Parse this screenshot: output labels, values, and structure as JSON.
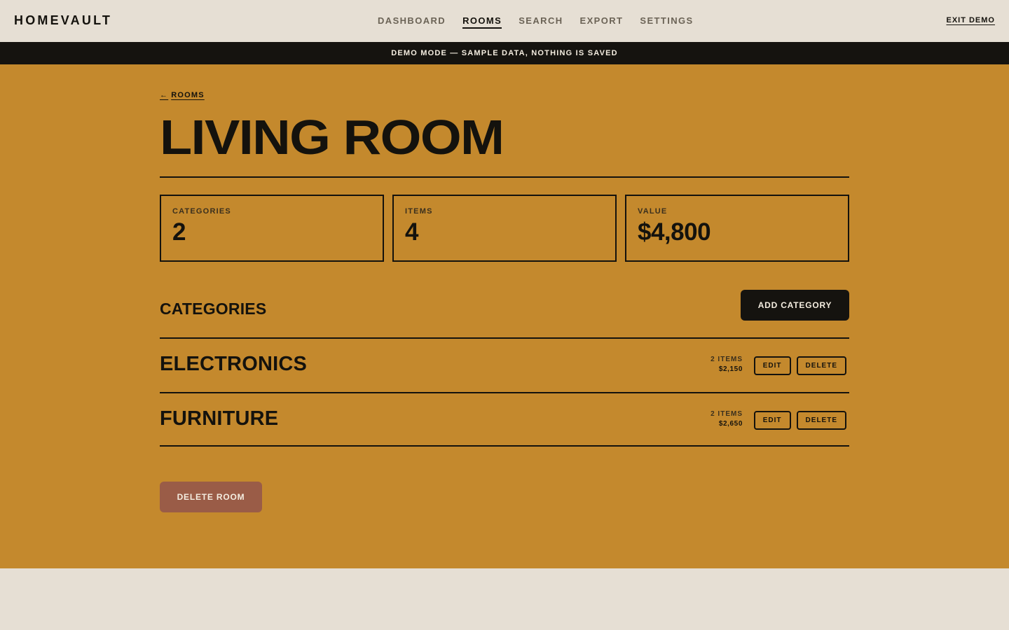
{
  "app": {
    "logo": "HOMEVAULT",
    "exit_label": "EXIT DEMO"
  },
  "nav": {
    "items": [
      {
        "label": "DASHBOARD",
        "active": false
      },
      {
        "label": "ROOMS",
        "active": true
      },
      {
        "label": "SEARCH",
        "active": false
      },
      {
        "label": "EXPORT",
        "active": false
      },
      {
        "label": "SETTINGS",
        "active": false
      }
    ]
  },
  "banner": {
    "text": "DEMO MODE — SAMPLE DATA, NOTHING IS SAVED"
  },
  "breadcrumb": {
    "arrow": "←",
    "label": "ROOMS"
  },
  "page": {
    "title": "LIVING ROOM"
  },
  "stats": [
    {
      "label": "CATEGORIES",
      "value": "2"
    },
    {
      "label": "ITEMS",
      "value": "4"
    },
    {
      "label": "VALUE",
      "value": "$4,800"
    }
  ],
  "categories_section": {
    "title": "CATEGORIES",
    "add_label": "ADD CATEGORY",
    "edit_label": "EDIT",
    "delete_label": "DELETE",
    "items": [
      {
        "name": "ELECTRONICS",
        "count": "2 ITEMS",
        "value": "$2,150"
      },
      {
        "name": "FURNITURE",
        "count": "2 ITEMS",
        "value": "$2,650"
      }
    ]
  },
  "danger": {
    "delete_room_label": "DELETE ROOM"
  },
  "colors": {
    "accent": "#c4892d",
    "dark": "#15130f",
    "light": "#e6dfd4",
    "danger": "#9a5c47"
  }
}
